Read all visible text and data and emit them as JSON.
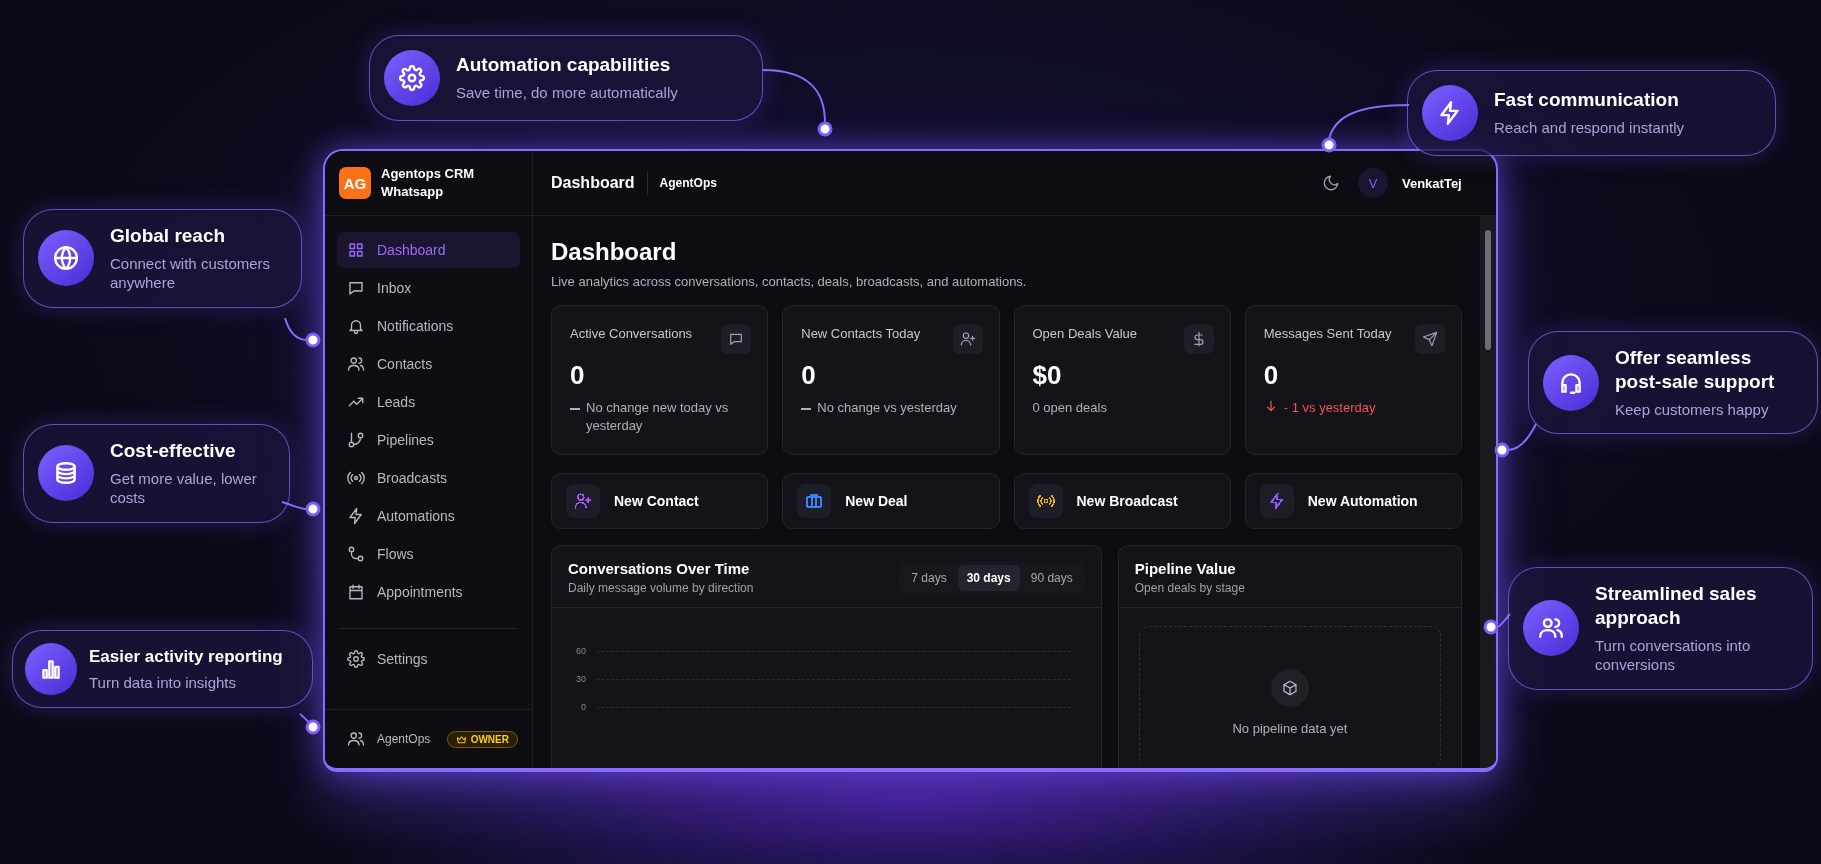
{
  "callouts": [
    {
      "title": "Automation capabilities",
      "subtitle": "Save time, do more automatically"
    },
    {
      "title": "Fast communication",
      "subtitle": "Reach and respond instantly"
    },
    {
      "title": "Global reach",
      "subtitle": "Connect with customers anywhere"
    },
    {
      "title": "Offer seamless post-sale support",
      "subtitle": "Keep customers happy"
    },
    {
      "title": "Cost-effective",
      "subtitle": "Get more value, lower costs"
    },
    {
      "title": "Streamlined sales approach",
      "subtitle": "Turn conversations into conversions"
    },
    {
      "title": "Easier activity reporting",
      "subtitle": "Turn data into insights"
    }
  ],
  "app": {
    "brand": {
      "initials": "AG",
      "name": "Agentops CRM Whatsapp"
    },
    "nav": [
      {
        "label": "Dashboard",
        "selected": true
      },
      {
        "label": "Inbox",
        "selected": false
      },
      {
        "label": "Notifications",
        "selected": false
      },
      {
        "label": "Contacts",
        "selected": false
      },
      {
        "label": "Leads",
        "selected": false
      },
      {
        "label": "Pipelines",
        "selected": false
      },
      {
        "label": "Broadcasts",
        "selected": false
      },
      {
        "label": "Automations",
        "selected": false
      },
      {
        "label": "Flows",
        "selected": false
      },
      {
        "label": "Appointments",
        "selected": false
      }
    ],
    "settings": "Settings",
    "footer": {
      "workspace": "AgentOps",
      "role": "OWNER"
    },
    "header": {
      "title": "Dashboard",
      "workspace": "AgentOps",
      "user_initial": "V",
      "user_name": "VenkatTej"
    },
    "page": {
      "title": "Dashboard",
      "subtitle": "Live analytics across conversations, contacts, deals, broadcasts, and automations."
    },
    "stats": [
      {
        "label": "Active Conversations",
        "value": "0",
        "note": "No change new today vs yesterday",
        "kind": "flat"
      },
      {
        "label": "New Contacts Today",
        "value": "0",
        "note": "No change vs yesterday",
        "kind": "flat"
      },
      {
        "label": "Open Deals Value",
        "value": "$0",
        "note": "0 open deals",
        "kind": "plain"
      },
      {
        "label": "Messages Sent Today",
        "value": "0",
        "note": "- 1 vs yesterday",
        "kind": "down"
      }
    ],
    "actions": [
      {
        "label": "New Contact",
        "color": "#a855f7"
      },
      {
        "label": "New Deal",
        "color": "#3b82f6"
      },
      {
        "label": "New Broadcast",
        "color": "#eab308"
      },
      {
        "label": "New Automation",
        "color": "#8b5cf6"
      }
    ],
    "conversations": {
      "title": "Conversations Over Time",
      "subtitle": "Daily message volume by direction",
      "ranges": [
        {
          "label": "7 days",
          "selected": false
        },
        {
          "label": "30 days",
          "selected": true
        },
        {
          "label": "90 days",
          "selected": false
        }
      ],
      "y_labels": [
        "60",
        "30",
        "0"
      ]
    },
    "pipeline": {
      "title": "Pipeline Value",
      "subtitle": "Open deals by stage",
      "empty_text": "No pipeline data yet"
    }
  }
}
